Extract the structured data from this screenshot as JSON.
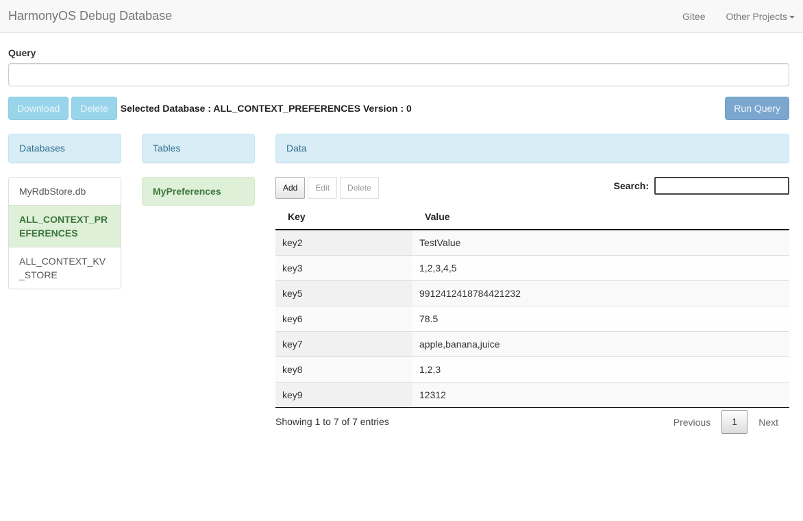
{
  "navbar": {
    "brand": "HarmonyOS Debug Database",
    "links": [
      {
        "label": "Gitee"
      },
      {
        "label": "Other Projects",
        "has_dropdown": true
      }
    ]
  },
  "query": {
    "label": "Query",
    "value": "",
    "placeholder": ""
  },
  "toolbar": {
    "download_label": "Download",
    "delete_label": "Delete",
    "selected_db_text": "Selected Database : ALL_CONTEXT_PREFERENCES Version : 0",
    "run_query_label": "Run Query"
  },
  "panels": {
    "databases_title": "Databases",
    "tables_title": "Tables",
    "data_title": "Data"
  },
  "databases": [
    {
      "name": "MyRdbStore.db",
      "active": false
    },
    {
      "name": "ALL_CONTEXT_PREFERENCES",
      "active": true
    },
    {
      "name": "ALL_CONTEXT_KV_STORE",
      "active": false
    }
  ],
  "tables": [
    {
      "name": "MyPreferences",
      "active": true
    }
  ],
  "data_actions": {
    "add_label": "Add",
    "edit_label": "Edit",
    "delete_label": "Delete"
  },
  "search": {
    "label": "Search:",
    "value": ""
  },
  "grid": {
    "columns": [
      "Key",
      "Value"
    ],
    "rows": [
      {
        "key": "key2",
        "value": "TestValue"
      },
      {
        "key": "key3",
        "value": "1,2,3,4,5"
      },
      {
        "key": "key5",
        "value": "9912412418784421232"
      },
      {
        "key": "key6",
        "value": "78.5"
      },
      {
        "key": "key7",
        "value": "apple,banana,juice"
      },
      {
        "key": "key8",
        "value": "1,2,3"
      },
      {
        "key": "key9",
        "value": "12312"
      }
    ]
  },
  "footer": {
    "info": "Showing 1 to 7 of 7 entries",
    "previous_label": "Previous",
    "current_page": "1",
    "next_label": "Next"
  }
}
